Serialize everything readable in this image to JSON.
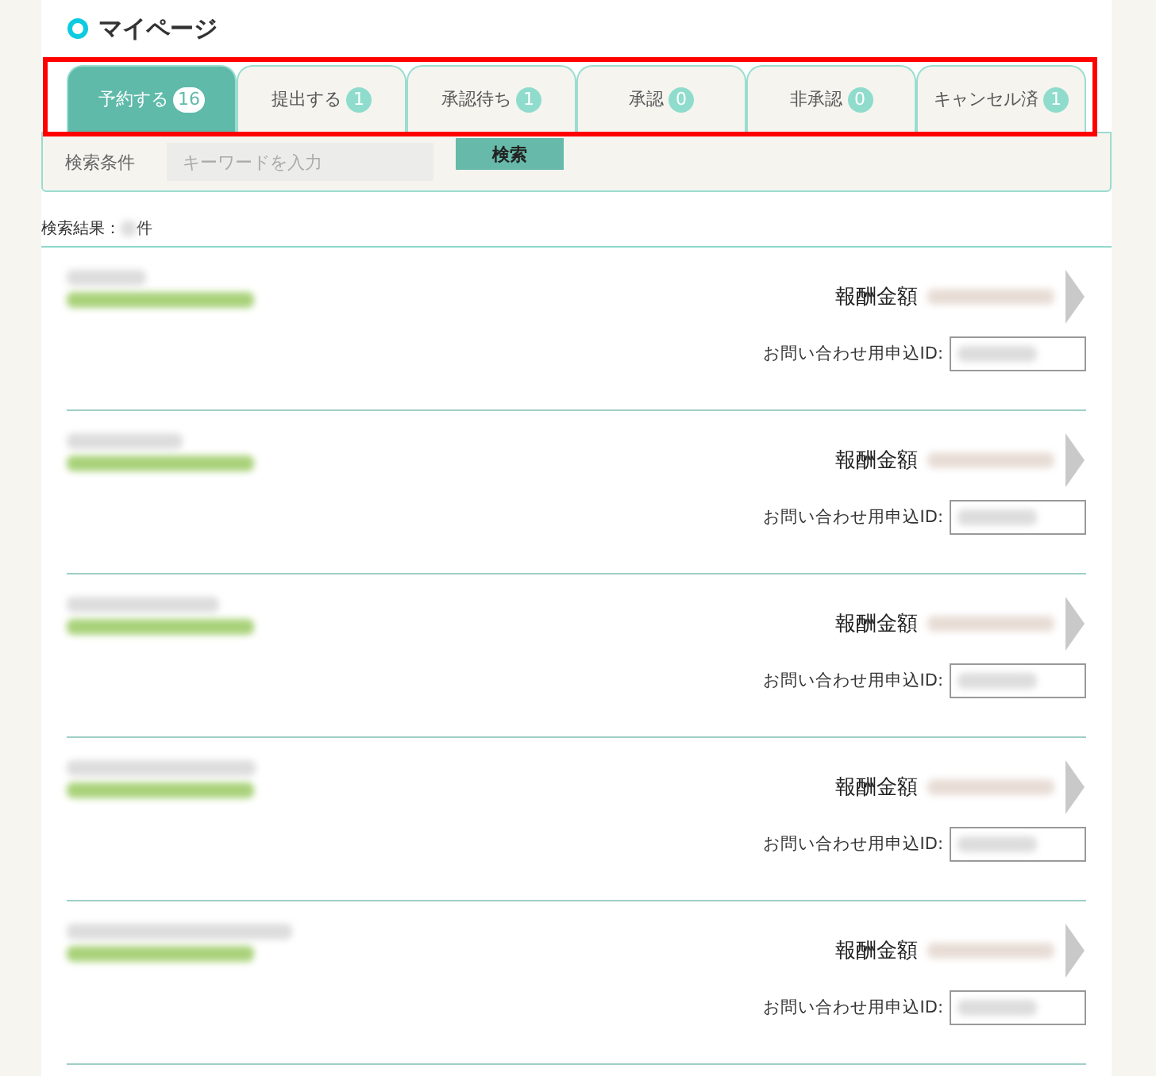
{
  "title": "マイページ",
  "tabs_highlighted": true,
  "tabs": [
    {
      "label": "予約する",
      "count": "16",
      "selected": true
    },
    {
      "label": "提出する",
      "count": "1",
      "selected": false
    },
    {
      "label": "承認待ち",
      "count": "1",
      "selected": false
    },
    {
      "label": "承認",
      "count": "0",
      "selected": false
    },
    {
      "label": "非承認",
      "count": "0",
      "selected": false
    },
    {
      "label": "キャンセル済",
      "count": "1",
      "selected": false
    }
  ],
  "search": {
    "label": "検索条件",
    "placeholder": "キーワードを入力",
    "button": "検索"
  },
  "results": {
    "prefix": "検索結果：",
    "suffix": "件"
  },
  "rows": [
    {
      "reward_label": "報酬金額",
      "id_label": "お問い合わせ用申込ID:"
    },
    {
      "reward_label": "報酬金額",
      "id_label": "お問い合わせ用申込ID:"
    },
    {
      "reward_label": "報酬金額",
      "id_label": "お問い合わせ用申込ID:"
    },
    {
      "reward_label": "報酬金額",
      "id_label": "お問い合わせ用申込ID:"
    },
    {
      "reward_label": "報酬金額",
      "id_label": "お問い合わせ用申込ID:"
    }
  ]
}
